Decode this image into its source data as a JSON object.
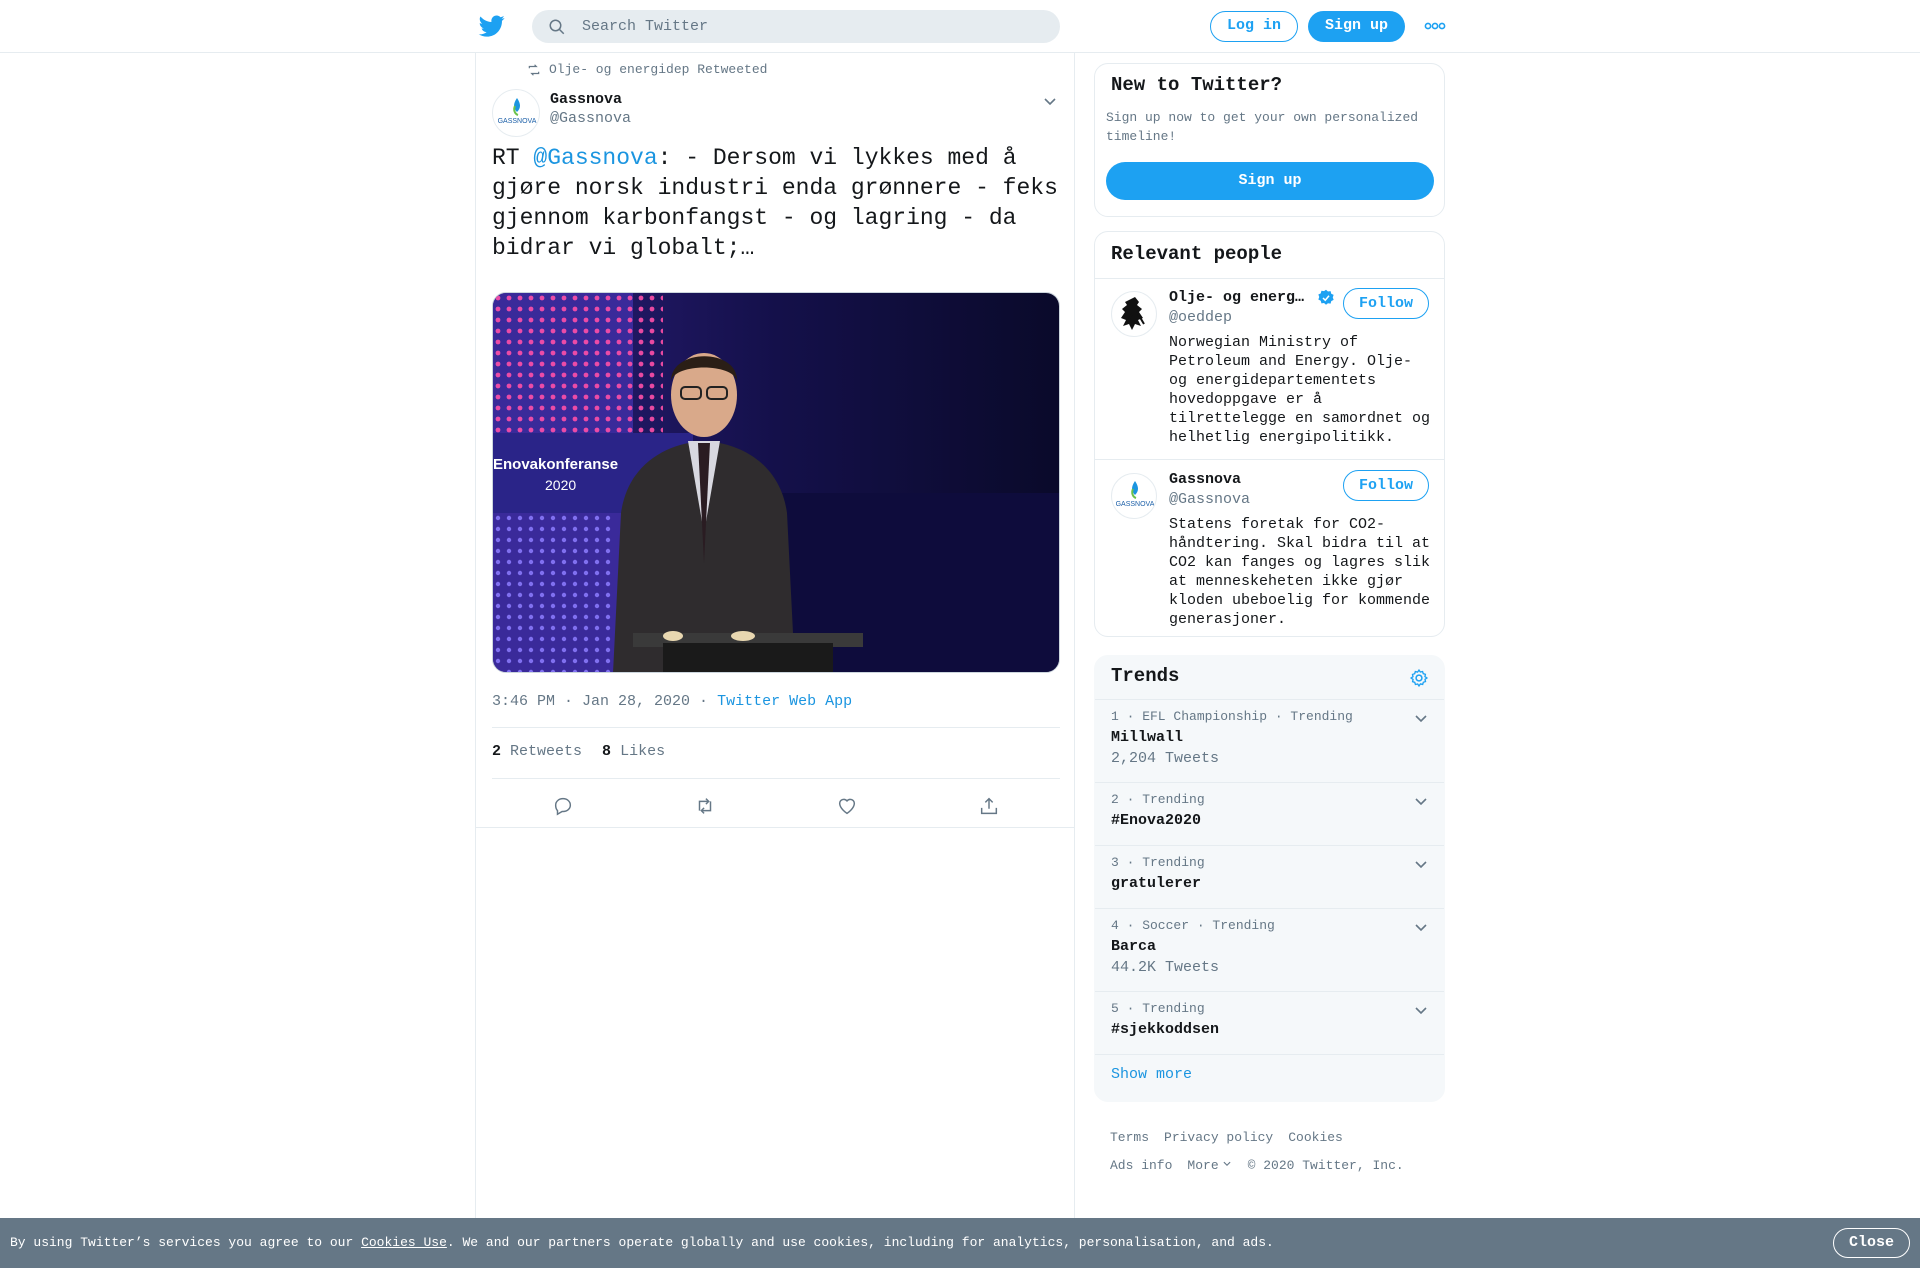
{
  "header": {
    "search_placeholder": "Search Twitter",
    "login_label": "Log in",
    "signup_label": "Sign up",
    "brand_color": "#1da1f2"
  },
  "tweet": {
    "retweeted_by": "Olje- og energidep Retweeted",
    "author_name": "Gassnova",
    "author_handle": "@Gassnova",
    "avatar_text": "GASSNOVA",
    "text_prefix": "RT ",
    "mention": "@Gassnova",
    "text_rest": ": - Dersom vi lykkes med å gjøre norsk industri enda grønnere - feks gjennom karbonfangst - og lagring - da bidrar vi globalt;…",
    "media_caption_line1": "Enovakonferanse",
    "media_caption_line2": "2020",
    "time": "3:46 PM · Jan 28, 2020",
    "separator": " · ",
    "source": "Twitter Web App",
    "retweets_count": "2",
    "retweets_label": "Retweets",
    "likes_count": "8",
    "likes_label": "Likes"
  },
  "new_to_twitter": {
    "title": "New to Twitter?",
    "description": "Sign up now to get your own personalized timeline!",
    "button": "Sign up"
  },
  "relevant_people": {
    "title": "Relevant people",
    "people": [
      {
        "name": "Olje- og energ…",
        "handle": "@oeddep",
        "verified": true,
        "bio": "Norwegian Ministry of Petroleum and Energy. Olje- og energidepartementets hovedoppgave er å tilrettelegge en samordnet og helhetlig energipolitikk.",
        "follow": "Follow"
      },
      {
        "name": "Gassnova",
        "handle": "@Gassnova",
        "verified": false,
        "bio": "Statens foretak for CO2-håndtering. Skal bidra til at CO2 kan fanges og lagres slik at menneskeheten ikke gjør kloden ubeboelig for kommende generasjoner.",
        "follow": "Follow"
      }
    ]
  },
  "trends": {
    "title": "Trends",
    "items": [
      {
        "meta": "1 · EFL Championship · Trending",
        "name": "Millwall",
        "count": "2,204 Tweets"
      },
      {
        "meta": "2 · Trending",
        "name": "#Enova2020",
        "count": ""
      },
      {
        "meta": "3 · Trending",
        "name": "gratulerer",
        "count": ""
      },
      {
        "meta": "4 · Soccer · Trending",
        "name": "Barca",
        "count": "44.2K Tweets"
      },
      {
        "meta": "5 · Trending",
        "name": "#sjekkoddsen",
        "count": ""
      }
    ],
    "show_more": "Show more"
  },
  "footer": {
    "terms": "Terms",
    "privacy": "Privacy policy",
    "cookies": "Cookies",
    "ads_info": "Ads info",
    "more": "More",
    "copyright": "© 2020 Twitter, Inc."
  },
  "cookie_bar": {
    "text_before": "By using Twitter’s services you agree to our ",
    "link": "Cookies Use",
    "text_after": ". We and our partners operate globally and use cookies, including for analytics, personalisation, and ads.",
    "close": "Close"
  }
}
